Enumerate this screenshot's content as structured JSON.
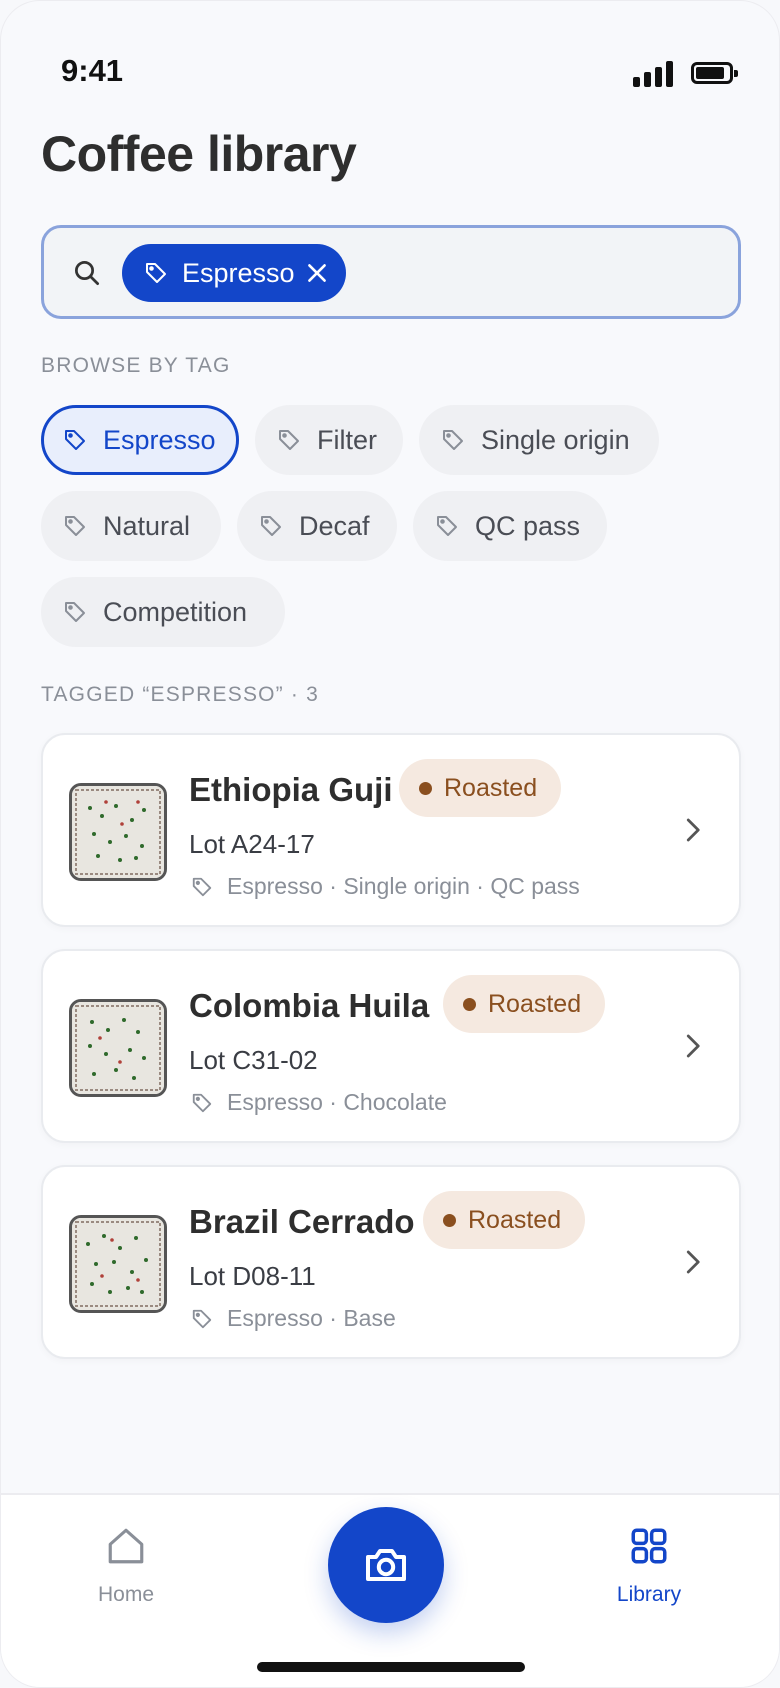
{
  "status_bar": {
    "time": "9:41"
  },
  "page_title": "Coffee library",
  "search": {
    "active_chip": "Espresso"
  },
  "browse_label": "BROWSE BY TAG",
  "tags": [
    {
      "label": "Espresso",
      "active": true
    },
    {
      "label": "Filter",
      "active": false
    },
    {
      "label": "Single origin",
      "active": false
    },
    {
      "label": "Natural",
      "active": false
    },
    {
      "label": "Decaf",
      "active": false
    },
    {
      "label": "QC pass",
      "active": false
    },
    {
      "label": "Competition",
      "active": false
    }
  ],
  "results_label": "TAGGED “ESPRESSO” · 3",
  "coffees": [
    {
      "name": "Ethiopia Guji",
      "status": "Roasted",
      "lot": "Lot A24-17",
      "tags": "Espresso · Single origin · QC pass"
    },
    {
      "name": "Colombia Huila",
      "status": "Roasted",
      "lot": "Lot C31-02",
      "tags": "Espresso · Chocolate"
    },
    {
      "name": "Brazil Cerrado",
      "status": "Roasted",
      "lot": "Lot D08-11",
      "tags": "Espresso · Base"
    }
  ],
  "nav": {
    "home": "Home",
    "library": "Library"
  },
  "colors": {
    "accent": "#1346c9",
    "badge_bg": "#f5e9e0",
    "badge_text": "#8a4f1f"
  }
}
